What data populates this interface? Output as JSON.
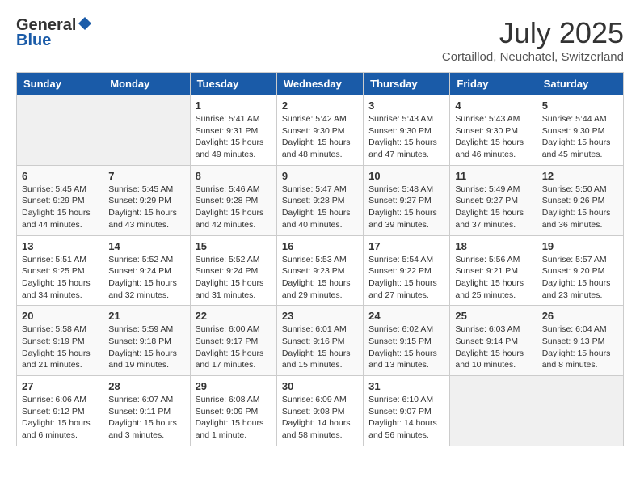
{
  "header": {
    "logo_general": "General",
    "logo_blue": "Blue",
    "month_title": "July 2025",
    "location": "Cortaillod, Neuchatel, Switzerland"
  },
  "weekdays": [
    "Sunday",
    "Monday",
    "Tuesday",
    "Wednesday",
    "Thursday",
    "Friday",
    "Saturday"
  ],
  "weeks": [
    [
      {
        "day": "",
        "sunrise": "",
        "sunset": "",
        "daylight": ""
      },
      {
        "day": "",
        "sunrise": "",
        "sunset": "",
        "daylight": ""
      },
      {
        "day": "1",
        "sunrise": "Sunrise: 5:41 AM",
        "sunset": "Sunset: 9:31 PM",
        "daylight": "Daylight: 15 hours and 49 minutes."
      },
      {
        "day": "2",
        "sunrise": "Sunrise: 5:42 AM",
        "sunset": "Sunset: 9:30 PM",
        "daylight": "Daylight: 15 hours and 48 minutes."
      },
      {
        "day": "3",
        "sunrise": "Sunrise: 5:43 AM",
        "sunset": "Sunset: 9:30 PM",
        "daylight": "Daylight: 15 hours and 47 minutes."
      },
      {
        "day": "4",
        "sunrise": "Sunrise: 5:43 AM",
        "sunset": "Sunset: 9:30 PM",
        "daylight": "Daylight: 15 hours and 46 minutes."
      },
      {
        "day": "5",
        "sunrise": "Sunrise: 5:44 AM",
        "sunset": "Sunset: 9:30 PM",
        "daylight": "Daylight: 15 hours and 45 minutes."
      }
    ],
    [
      {
        "day": "6",
        "sunrise": "Sunrise: 5:45 AM",
        "sunset": "Sunset: 9:29 PM",
        "daylight": "Daylight: 15 hours and 44 minutes."
      },
      {
        "day": "7",
        "sunrise": "Sunrise: 5:45 AM",
        "sunset": "Sunset: 9:29 PM",
        "daylight": "Daylight: 15 hours and 43 minutes."
      },
      {
        "day": "8",
        "sunrise": "Sunrise: 5:46 AM",
        "sunset": "Sunset: 9:28 PM",
        "daylight": "Daylight: 15 hours and 42 minutes."
      },
      {
        "day": "9",
        "sunrise": "Sunrise: 5:47 AM",
        "sunset": "Sunset: 9:28 PM",
        "daylight": "Daylight: 15 hours and 40 minutes."
      },
      {
        "day": "10",
        "sunrise": "Sunrise: 5:48 AM",
        "sunset": "Sunset: 9:27 PM",
        "daylight": "Daylight: 15 hours and 39 minutes."
      },
      {
        "day": "11",
        "sunrise": "Sunrise: 5:49 AM",
        "sunset": "Sunset: 9:27 PM",
        "daylight": "Daylight: 15 hours and 37 minutes."
      },
      {
        "day": "12",
        "sunrise": "Sunrise: 5:50 AM",
        "sunset": "Sunset: 9:26 PM",
        "daylight": "Daylight: 15 hours and 36 minutes."
      }
    ],
    [
      {
        "day": "13",
        "sunrise": "Sunrise: 5:51 AM",
        "sunset": "Sunset: 9:25 PM",
        "daylight": "Daylight: 15 hours and 34 minutes."
      },
      {
        "day": "14",
        "sunrise": "Sunrise: 5:52 AM",
        "sunset": "Sunset: 9:24 PM",
        "daylight": "Daylight: 15 hours and 32 minutes."
      },
      {
        "day": "15",
        "sunrise": "Sunrise: 5:52 AM",
        "sunset": "Sunset: 9:24 PM",
        "daylight": "Daylight: 15 hours and 31 minutes."
      },
      {
        "day": "16",
        "sunrise": "Sunrise: 5:53 AM",
        "sunset": "Sunset: 9:23 PM",
        "daylight": "Daylight: 15 hours and 29 minutes."
      },
      {
        "day": "17",
        "sunrise": "Sunrise: 5:54 AM",
        "sunset": "Sunset: 9:22 PM",
        "daylight": "Daylight: 15 hours and 27 minutes."
      },
      {
        "day": "18",
        "sunrise": "Sunrise: 5:56 AM",
        "sunset": "Sunset: 9:21 PM",
        "daylight": "Daylight: 15 hours and 25 minutes."
      },
      {
        "day": "19",
        "sunrise": "Sunrise: 5:57 AM",
        "sunset": "Sunset: 9:20 PM",
        "daylight": "Daylight: 15 hours and 23 minutes."
      }
    ],
    [
      {
        "day": "20",
        "sunrise": "Sunrise: 5:58 AM",
        "sunset": "Sunset: 9:19 PM",
        "daylight": "Daylight: 15 hours and 21 minutes."
      },
      {
        "day": "21",
        "sunrise": "Sunrise: 5:59 AM",
        "sunset": "Sunset: 9:18 PM",
        "daylight": "Daylight: 15 hours and 19 minutes."
      },
      {
        "day": "22",
        "sunrise": "Sunrise: 6:00 AM",
        "sunset": "Sunset: 9:17 PM",
        "daylight": "Daylight: 15 hours and 17 minutes."
      },
      {
        "day": "23",
        "sunrise": "Sunrise: 6:01 AM",
        "sunset": "Sunset: 9:16 PM",
        "daylight": "Daylight: 15 hours and 15 minutes."
      },
      {
        "day": "24",
        "sunrise": "Sunrise: 6:02 AM",
        "sunset": "Sunset: 9:15 PM",
        "daylight": "Daylight: 15 hours and 13 minutes."
      },
      {
        "day": "25",
        "sunrise": "Sunrise: 6:03 AM",
        "sunset": "Sunset: 9:14 PM",
        "daylight": "Daylight: 15 hours and 10 minutes."
      },
      {
        "day": "26",
        "sunrise": "Sunrise: 6:04 AM",
        "sunset": "Sunset: 9:13 PM",
        "daylight": "Daylight: 15 hours and 8 minutes."
      }
    ],
    [
      {
        "day": "27",
        "sunrise": "Sunrise: 6:06 AM",
        "sunset": "Sunset: 9:12 PM",
        "daylight": "Daylight: 15 hours and 6 minutes."
      },
      {
        "day": "28",
        "sunrise": "Sunrise: 6:07 AM",
        "sunset": "Sunset: 9:11 PM",
        "daylight": "Daylight: 15 hours and 3 minutes."
      },
      {
        "day": "29",
        "sunrise": "Sunrise: 6:08 AM",
        "sunset": "Sunset: 9:09 PM",
        "daylight": "Daylight: 15 hours and 1 minute."
      },
      {
        "day": "30",
        "sunrise": "Sunrise: 6:09 AM",
        "sunset": "Sunset: 9:08 PM",
        "daylight": "Daylight: 14 hours and 58 minutes."
      },
      {
        "day": "31",
        "sunrise": "Sunrise: 6:10 AM",
        "sunset": "Sunset: 9:07 PM",
        "daylight": "Daylight: 14 hours and 56 minutes."
      },
      {
        "day": "",
        "sunrise": "",
        "sunset": "",
        "daylight": ""
      },
      {
        "day": "",
        "sunrise": "",
        "sunset": "",
        "daylight": ""
      }
    ]
  ]
}
